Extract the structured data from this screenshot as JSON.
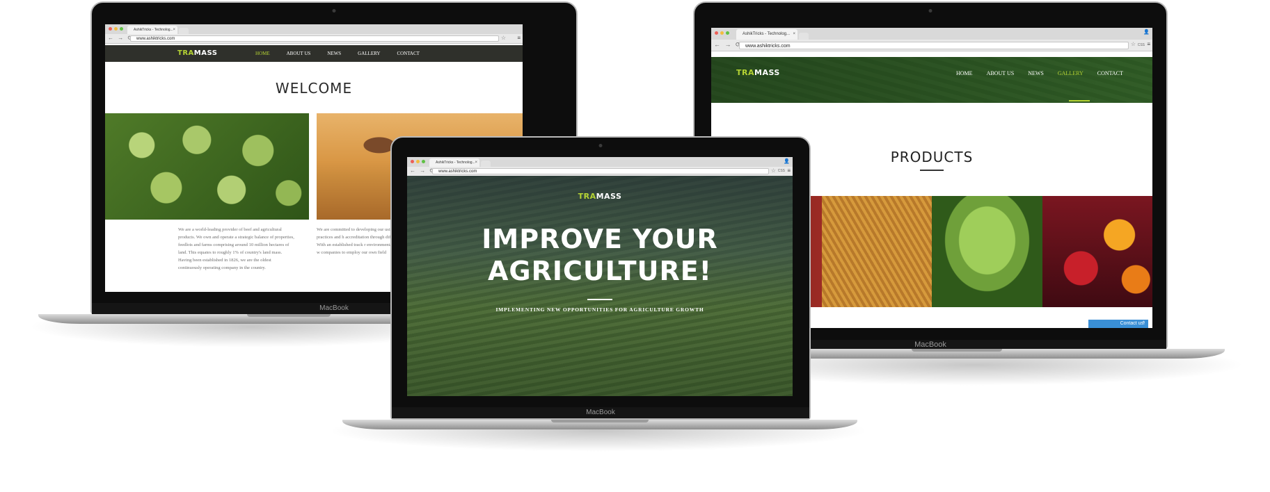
{
  "device_label": "MacBook",
  "browser": {
    "tab_title": "AshikTricks - Technolog...",
    "url": "www.ashiktricks.com",
    "css_label": "CSS"
  },
  "site": {
    "logo_a": "TRA",
    "logo_b": "MASS",
    "nav": [
      "HOME",
      "ABOUT US",
      "NEWS",
      "GALLERY",
      "CONTACT"
    ]
  },
  "left": {
    "heading": "WELCOME",
    "para1": "We are a world-leading provider of beef and agricultural products. We own and operate a strategic balance of properties, feedlots and farms comprising around 10 million hectares of land. This equates to roughly 1% of country's land mass. Having been established in 1826, we are the oldest continuously operating company in the country.",
    "para2": "We are committed to developing our using the world's best practices and h accreditation through different quali programs. With an established track r environmentally sensitive land use, w companies to employ our own field"
  },
  "center": {
    "headline_1": "IMPROVE YOUR",
    "headline_2": "AGRICULTURE!",
    "tagline": "IMPLEMENTING NEW OPPORTUNITIES FOR AGRICULTURE GROWTH"
  },
  "right": {
    "heading": "PRODUCTS",
    "contact_widget": "Contact us!",
    "contact_caret": "^"
  },
  "colors": {
    "accent": "#b5d334",
    "nav_bg": "#2f302b"
  }
}
